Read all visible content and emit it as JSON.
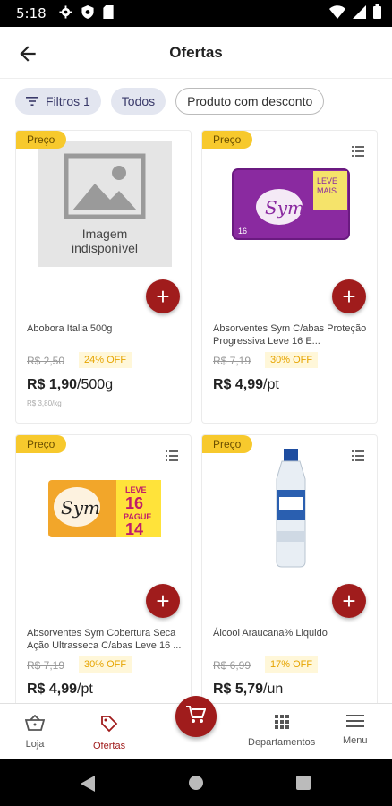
{
  "status": {
    "time": "5:18"
  },
  "header": {
    "title": "Ofertas"
  },
  "filters": {
    "filtros_label": "Filtros 1",
    "todos_label": "Todos",
    "desconto_label": "Produto com desconto"
  },
  "products": [
    {
      "tag": "Preço",
      "image_text_1": "Imagem",
      "image_text_2": "indisponível",
      "name": "Abobora Italia 500g",
      "old_price": "R$ 2,50",
      "discount": "24% OFF",
      "price": "R$ 1,90",
      "unit": "/500g",
      "unit_price": "R$ 3,80/kg"
    },
    {
      "tag": "Preço",
      "name": "Absorventes Sym C/abas Proteção Progressiva Leve 16 E...",
      "old_price": "R$ 7,19",
      "discount": "30% OFF",
      "price": "R$ 4,99",
      "unit": "/pt"
    },
    {
      "tag": "Preço",
      "name": "Absorventes Sym Cobertura Seca Ação Ultrasseca C/abas Leve 16 ...",
      "old_price": "R$ 7,19",
      "discount": "30% OFF",
      "price": "R$ 4,99",
      "unit": "/pt"
    },
    {
      "tag": "Preço",
      "name": "Álcool Araucana% Liquido",
      "old_price": "R$ 6,99",
      "discount": "17% OFF",
      "price": "R$ 5,79",
      "unit": "/un"
    }
  ],
  "package_texts": {
    "brand": "Sym",
    "leve_mais": "LEVE MAIS",
    "leve": "LEVE",
    "sixteen": "16",
    "pague": "PAGUE",
    "fourteen": "14"
  },
  "bottom_nav": {
    "loja": "Loja",
    "ofertas": "Ofertas",
    "departamentos": "Departamentos",
    "menu": "Menu"
  },
  "colors": {
    "accent": "#a01c1c",
    "tag": "#f7c92d",
    "chip": "#e3e6f0"
  }
}
